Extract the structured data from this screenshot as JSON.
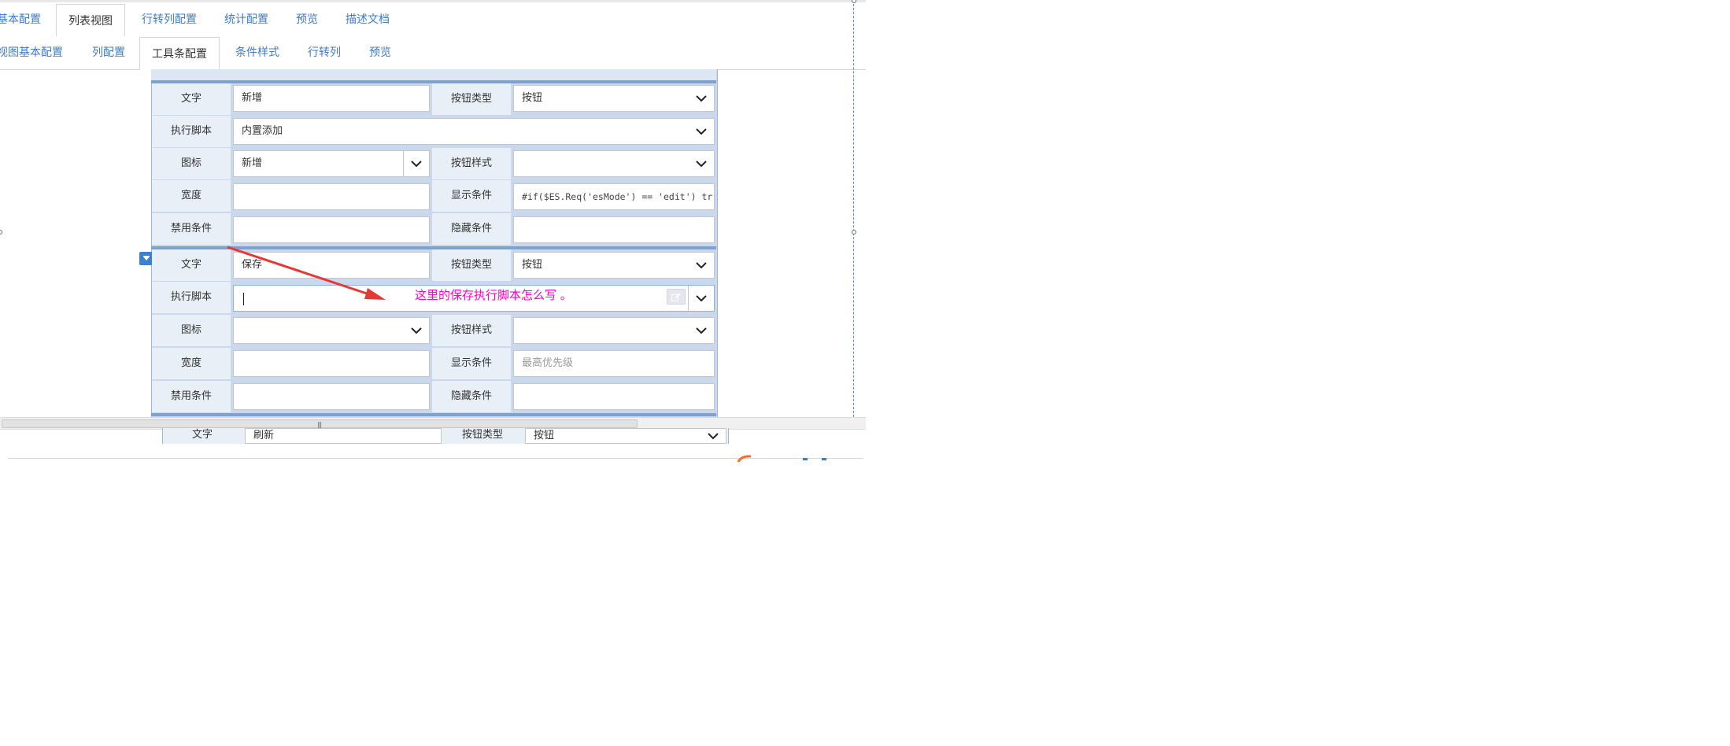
{
  "top_tabs": [
    {
      "label": "基本配置",
      "active": false
    },
    {
      "label": "列表视图",
      "active": true
    },
    {
      "label": "行转列配置",
      "active": false
    },
    {
      "label": "统计配置",
      "active": false
    },
    {
      "label": "预览",
      "active": false
    },
    {
      "label": "描述文档",
      "active": false
    }
  ],
  "sub_tabs": [
    {
      "label": "视图基本配置",
      "active": false
    },
    {
      "label": "列配置",
      "active": false
    },
    {
      "label": "工具条配置",
      "active": true
    },
    {
      "label": "条件样式",
      "active": false
    },
    {
      "label": "行转列",
      "active": false
    },
    {
      "label": "预览",
      "active": false
    }
  ],
  "labels": {
    "text": "文字",
    "button_type": "按钮类型",
    "exec_script": "执行脚本",
    "icon": "图标",
    "button_style": "按钮样式",
    "width": "宽度",
    "show_condition": "显示条件",
    "disable_condition": "禁用条件",
    "hide_condition": "隐藏条件"
  },
  "button1": {
    "text": "新增",
    "button_type": "按钮",
    "exec_script": "内置添加",
    "icon": "新增",
    "button_style": "",
    "width": "",
    "show_condition": "#if($ES.Req('esMode') == 'edit') tr",
    "disable_condition": "",
    "hide_condition": ""
  },
  "button2": {
    "text": "保存",
    "button_type": "按钮",
    "exec_script": "",
    "icon": "",
    "button_style": "",
    "width": "",
    "show_condition_placeholder": "最高优先级",
    "disable_condition": "",
    "hide_condition": ""
  },
  "button3": {
    "text": "刷新",
    "button_type": "按钮"
  },
  "annotation": "这里的保存执行脚本怎么写 。",
  "colors": {
    "tab_link": "#3f7cc4",
    "label_bg": "#e9eff7",
    "group_separator": "#7fa1ce",
    "annotation": "#ff00cc",
    "arrow": "#e53935"
  },
  "icons": [
    "chevron-down-icon",
    "edit-icon",
    "collapse-icon",
    "arrow"
  ]
}
